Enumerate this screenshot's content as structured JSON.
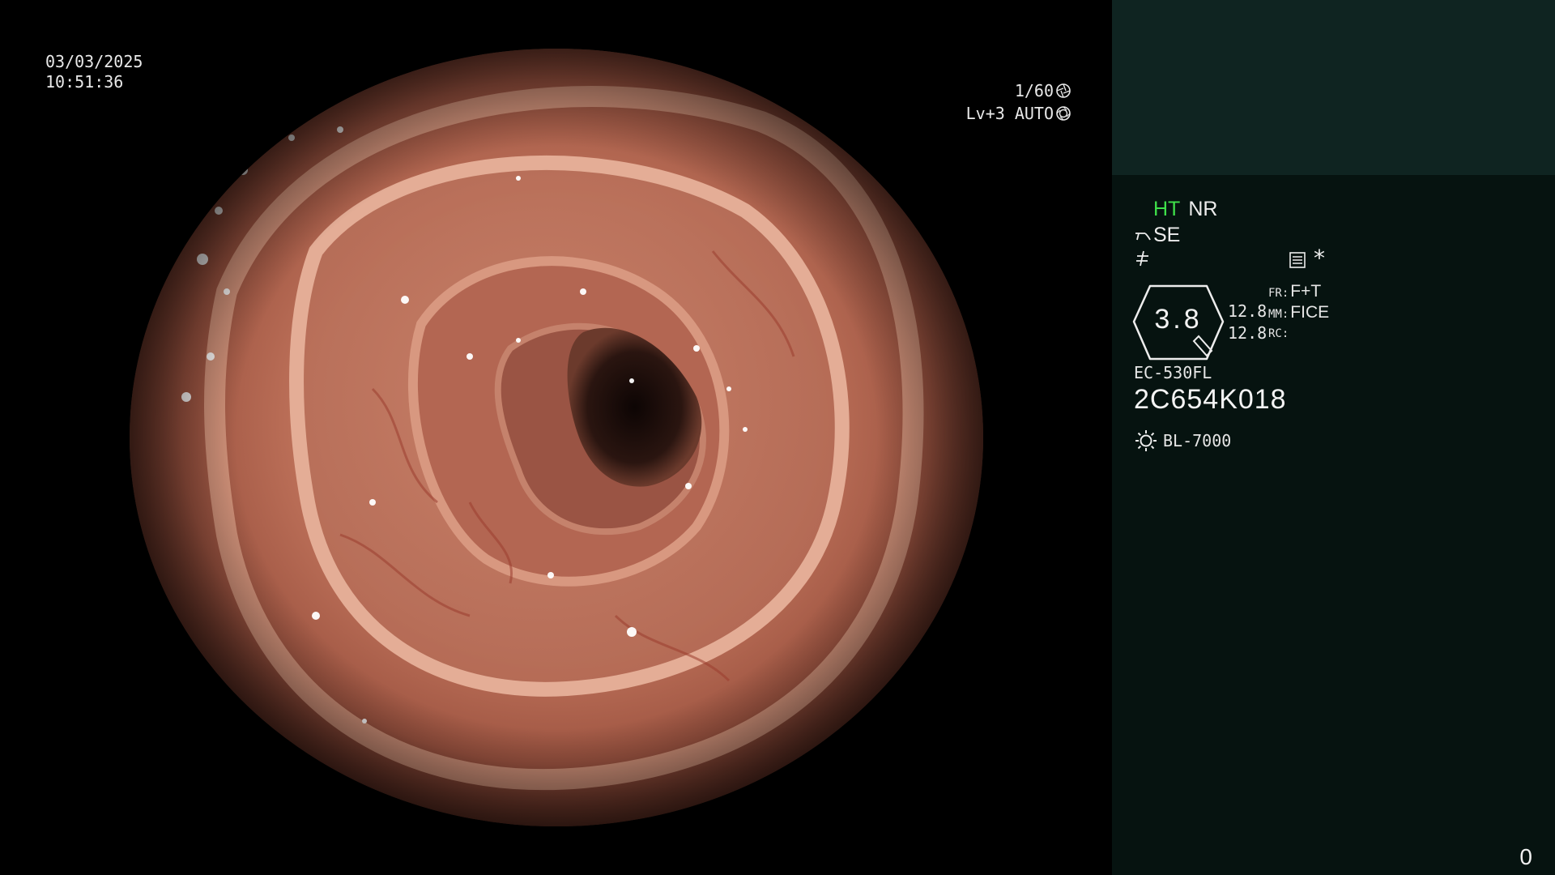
{
  "osd": {
    "date": "03/03/2025",
    "time": "10:51:36",
    "shutter": "1/60",
    "shutter_icon": "shutter-icon",
    "iris": "Lv+3 AUTO",
    "iris_icon": "iris-icon"
  },
  "panel": {
    "ht_label": "HT",
    "nr_label": "NR",
    "se_label": "SE",
    "se_icon": "structure-enhance-icon",
    "edge_icon": "edge-icon",
    "menu_icon": "menu-icon",
    "star": "*",
    "zoom_value": "3.8",
    "mm_values": [
      "12.8",
      "12.8"
    ],
    "modes": [
      {
        "key": "FR:",
        "value": "F+T"
      },
      {
        "key": "MM:",
        "value": "FICE"
      },
      {
        "key": "RC:",
        "value": ""
      }
    ],
    "scope_model": "EC-530FL",
    "scope_serial": "2C654K018",
    "light_source": "BL-7000",
    "light_icon": "light-source-icon",
    "counter": "0"
  },
  "colors": {
    "panel_top": "#0f2421",
    "panel_body": "#061310",
    "ht_accent": "#3fe04a",
    "text": "#ededed"
  }
}
